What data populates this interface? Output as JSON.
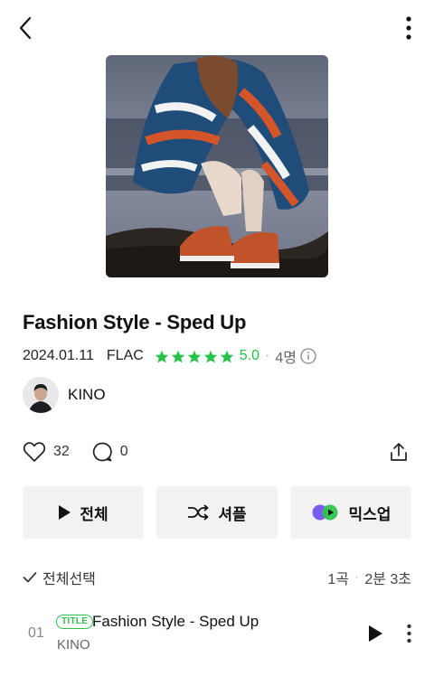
{
  "header": {
    "back_icon": "chevron-left-icon",
    "more_icon": "more-vertical-icon"
  },
  "album": {
    "title": "Fashion Style - Sped Up",
    "date": "2024.01.11",
    "format": "FLAC",
    "rating": "5.0",
    "stars": 5,
    "rating_count": "4명",
    "star_color": "#26c24a"
  },
  "artist": {
    "name": "KINO"
  },
  "social": {
    "likes": "32",
    "comments": "0"
  },
  "buttons": {
    "play_all": "전체",
    "shuffle": "셔플",
    "mixup": "믹스업"
  },
  "list": {
    "select_all": "전체선택",
    "track_count": "1곡",
    "duration": "2분 3초"
  },
  "tracks": [
    {
      "number": "01",
      "badge": "TITLE",
      "title": "Fashion Style - Sped Up",
      "artist": "KINO"
    }
  ],
  "colors": {
    "accent": "#2fc24e",
    "button_bg": "#f2f2f3"
  }
}
